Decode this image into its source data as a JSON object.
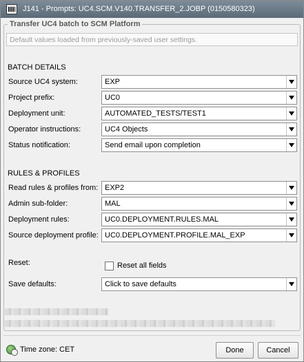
{
  "window": {
    "title": "J141 - Prompts: UC4.SCM.V140.TRANSFER_2.JOBP (0150580323)"
  },
  "group": {
    "title": "Transfer UC4 batch to SCM Platform",
    "info": "Default values loaded from previously-saved user settings."
  },
  "batch_details": {
    "heading": "BATCH DETAILS",
    "fields": [
      {
        "label": "Source UC4 system:",
        "value": "EXP"
      },
      {
        "label": "Project prefix:",
        "value": "UC0"
      },
      {
        "label": "Deployment unit:",
        "value": "AUTOMATED_TESTS/TEST1"
      },
      {
        "label": "Operator instructions:",
        "value": "UC4 Objects"
      },
      {
        "label": "Status notification:",
        "value": "Send email upon completion"
      }
    ]
  },
  "rules_profiles": {
    "heading": "RULES & PROFILES",
    "fields": [
      {
        "label": "Read rules & profiles from:",
        "value": "EXP2"
      },
      {
        "label": "Admin sub-folder:",
        "value": "MAL"
      },
      {
        "label": "Deployment rules:",
        "value": "UC0.DEPLOYMENT.RULES.MAL"
      },
      {
        "label": "Source deployment profile:",
        "value": "UC0.DEPLOYMENT.PROFILE.MAL_EXP"
      }
    ]
  },
  "reset": {
    "label": "Reset:",
    "checkbox_label": "Reset all fields",
    "checked": false
  },
  "save_defaults": {
    "label": "Save defaults:",
    "value": "Click to save defaults"
  },
  "footer": {
    "timezone": "Time zone: CET",
    "done_label": "Done",
    "cancel_label": "Cancel"
  },
  "icons": {
    "title_icon": "application-icon",
    "timezone_icon": "globe-clock-icon",
    "dropdown_icon": "chevron-down-icon"
  }
}
